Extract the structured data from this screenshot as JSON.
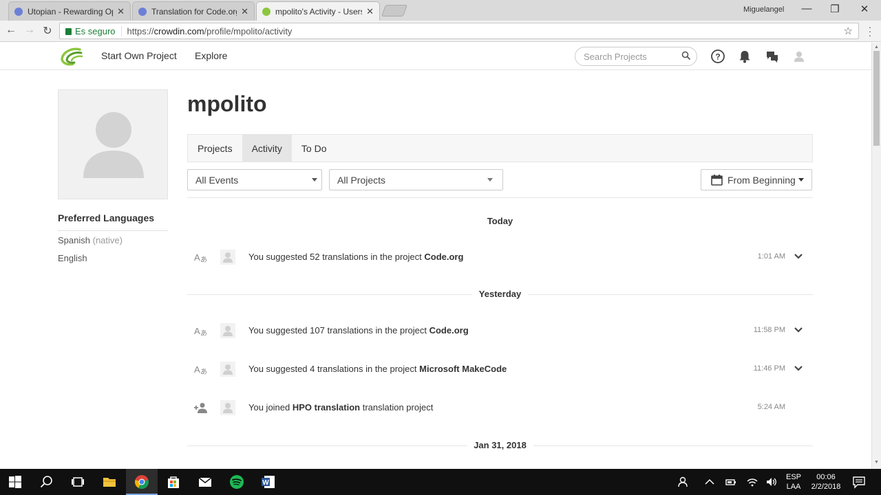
{
  "browser": {
    "tabs": [
      {
        "title": "Utopian - Rewarding Op",
        "favicon_color": "#6b7fd7"
      },
      {
        "title": "Translation for Code.org",
        "favicon_color": "#6b7fd7"
      },
      {
        "title": "mpolito's Activity - Users",
        "favicon_color": "#8cc63f"
      }
    ],
    "window_user": "Miguelangel",
    "secure_label": "Es seguro",
    "url_scheme": "https://",
    "url_host": "crowdin.com",
    "url_path": "/profile/mpolito/activity"
  },
  "header": {
    "nav": [
      "Start Own Project",
      "Explore"
    ],
    "search_placeholder": "Search Projects"
  },
  "profile": {
    "username": "mpolito",
    "preferred_languages_title": "Preferred Languages",
    "languages": [
      {
        "name": "Spanish",
        "note": "(native)"
      },
      {
        "name": "English",
        "note": ""
      }
    ]
  },
  "tabs": [
    "Projects",
    "Activity",
    "To Do"
  ],
  "active_tab": "Activity",
  "filters": {
    "events": "All Events",
    "projects": "All Projects",
    "date": "From Beginning"
  },
  "activity": {
    "groups": [
      {
        "day": "Today",
        "events": [
          {
            "type": "suggest",
            "prefix": "You suggested 52 translations in the project ",
            "bold": "Code.org",
            "suffix": "",
            "time": "1:01 AM",
            "expandable": true
          }
        ]
      },
      {
        "day": "Yesterday",
        "events": [
          {
            "type": "suggest",
            "prefix": "You suggested 107 translations in the project ",
            "bold": "Code.org",
            "suffix": "",
            "time": "11:58 PM",
            "expandable": true
          },
          {
            "type": "suggest",
            "prefix": "You suggested 4 translations in the project ",
            "bold": "Microsoft MakeCode",
            "suffix": "",
            "time": "11:46 PM",
            "expandable": true
          },
          {
            "type": "join",
            "prefix": "You joined ",
            "bold": "HPO translation",
            "suffix": " translation project",
            "time": "5:24 AM",
            "expandable": false
          }
        ]
      },
      {
        "day": "Jan 31, 2018",
        "events": []
      }
    ]
  },
  "taskbar": {
    "lang_top": "ESP",
    "lang_bottom": "LAA",
    "time": "00:06",
    "date": "2/2/2018"
  }
}
